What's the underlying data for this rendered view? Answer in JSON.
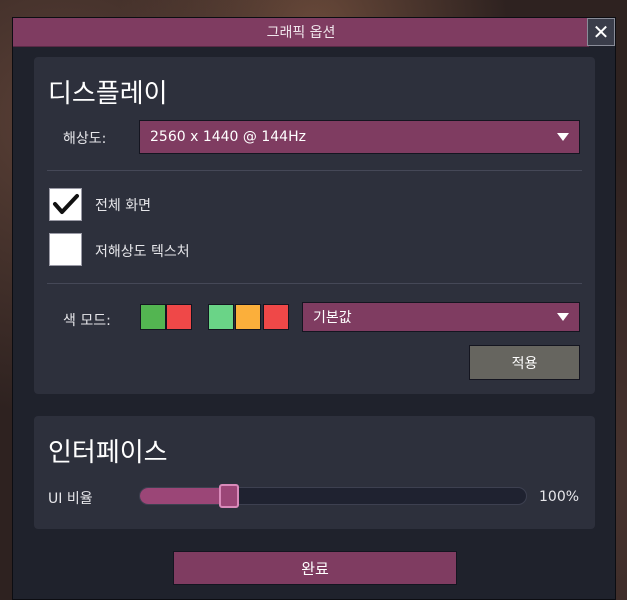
{
  "window": {
    "title": "그래픽 옵션"
  },
  "display": {
    "section_title": "디스플레이",
    "resolution_label": "해상도:",
    "resolution_value": "2560 x 1440 @ 144Hz",
    "fullscreen": {
      "label": "전체 화면",
      "checked": true
    },
    "low_res_textures": {
      "label": "저해상도 텍스처",
      "checked": false
    },
    "color_mode_label": "색 모드:",
    "color_mode_swatches_a": [
      "#53b551",
      "#ef4848"
    ],
    "color_mode_swatches_b": [
      "#6ad487",
      "#fbaf3b",
      "#ef4848"
    ],
    "color_mode_value": "기본값",
    "apply_label": "적용"
  },
  "interface": {
    "section_title": "인터페이스",
    "ui_scale_label": "UI 비율",
    "ui_scale_value": "100%",
    "ui_scale_fraction": 0.23
  },
  "done_label": "완료",
  "colors": {
    "accent": "#7f3c61",
    "panel": "#2d303c",
    "dialog_bg": "#1f222c"
  }
}
